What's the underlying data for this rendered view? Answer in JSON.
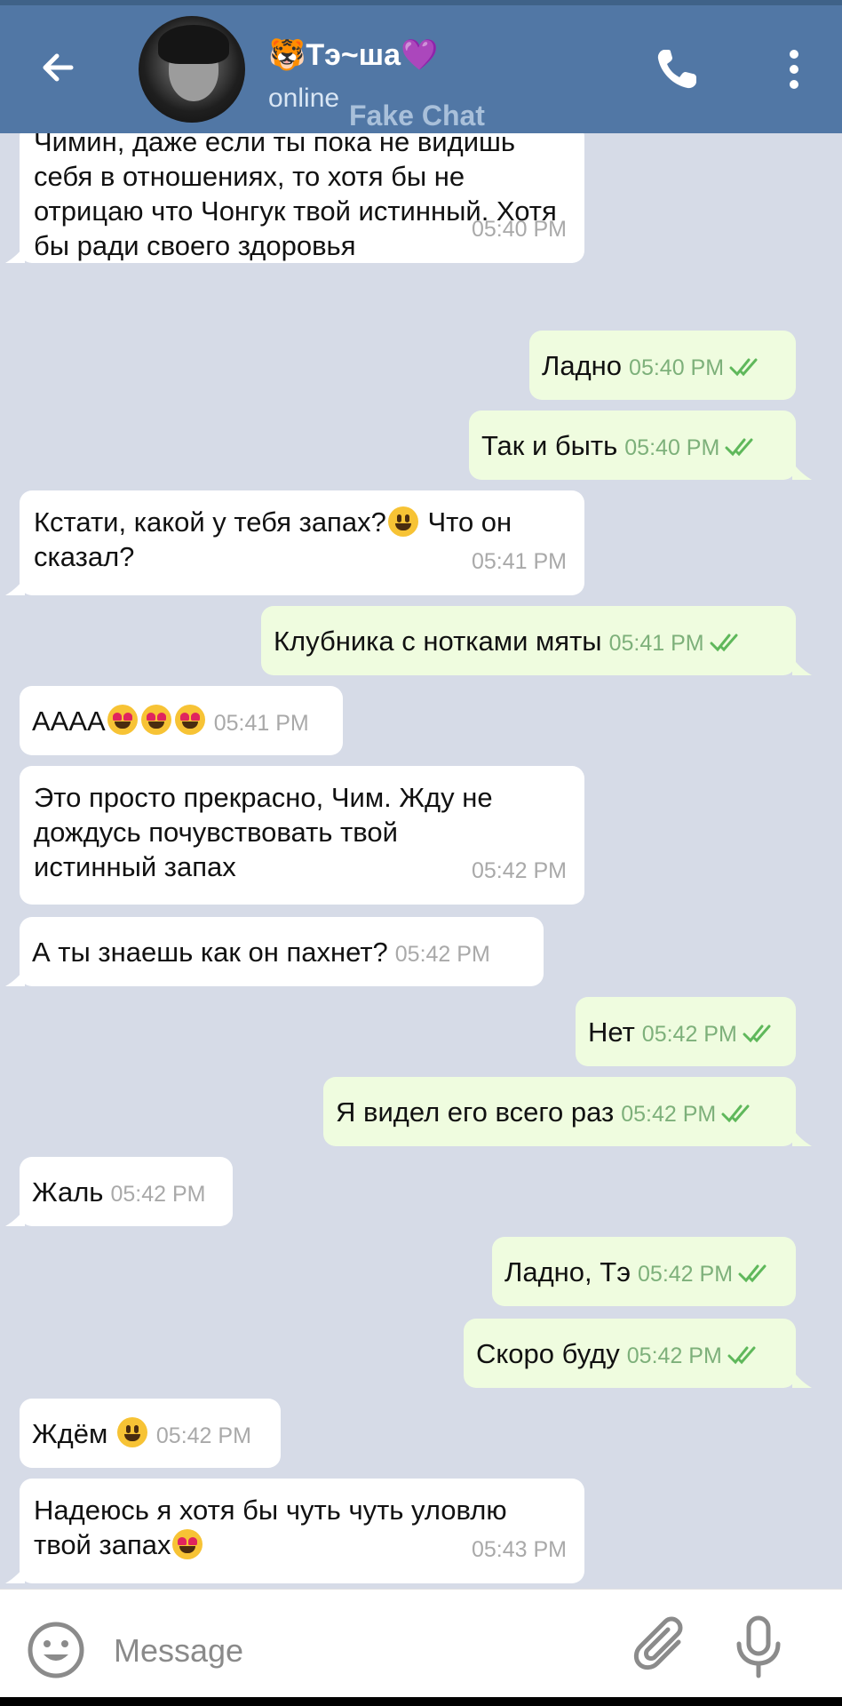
{
  "header": {
    "back_icon": "arrow-left-icon",
    "title": "🐯Тэ~ша💜",
    "status": "online",
    "watermark": "Fake Chat",
    "call_icon": "phone-icon",
    "more_icon": "more-vertical-icon",
    "accent_color": "#5177a5"
  },
  "messages": [
    {
      "dir": "in",
      "text": "Чимин, даже если ты пока не видишь себя в отношениях, то хотя бы не отрицаю что Чонгук твой истинный. Хотя бы ради своего здоровья",
      "time": "05:40 PM"
    },
    {
      "dir": "out",
      "text": "Ладно",
      "time": "05:40 PM",
      "read": true
    },
    {
      "dir": "out",
      "text": "Так и быть",
      "time": "05:40 PM",
      "read": true
    },
    {
      "dir": "in",
      "text": "Кстати, какой у тебя запах?😃 Что он сказал?",
      "time": "05:41 PM"
    },
    {
      "dir": "out",
      "text": "Клубника с нотками мяты",
      "time": "05:41 PM",
      "read": true
    },
    {
      "dir": "in",
      "text": "АААА😍😍😍",
      "time": "05:41 PM"
    },
    {
      "dir": "in",
      "text": "Это просто прекрасно, Чим. Жду не дождусь почувствовать твой истинный запах",
      "time": "05:42 PM"
    },
    {
      "dir": "in",
      "text": "А ты знаешь как он пахнет?",
      "time": "05:42 PM"
    },
    {
      "dir": "out",
      "text": "Нет",
      "time": "05:42 PM",
      "read": true
    },
    {
      "dir": "out",
      "text": "Я видел его всего раз",
      "time": "05:42 PM",
      "read": true
    },
    {
      "dir": "in",
      "text": "Жаль",
      "time": "05:42 PM"
    },
    {
      "dir": "out",
      "text": "Ладно, Тэ",
      "time": "05:42 PM",
      "read": true
    },
    {
      "dir": "out",
      "text": "Скоро буду",
      "time": "05:42 PM",
      "read": true
    },
    {
      "dir": "in",
      "text": "Ждём 😃",
      "time": "05:42 PM"
    },
    {
      "dir": "in",
      "text": "Надеюсь я хотя бы чуть чуть уловлю твой запах😍",
      "time": "05:43 PM"
    }
  ],
  "input": {
    "placeholder": "Message",
    "emoji_icon": "smile-icon",
    "attach_icon": "paperclip-icon",
    "mic_icon": "microphone-icon"
  },
  "colors": {
    "chat_background": "#d6dbe7",
    "incoming_bubble": "#ffffff",
    "outgoing_bubble": "#effcdf",
    "read_check": "#5fb85b"
  }
}
